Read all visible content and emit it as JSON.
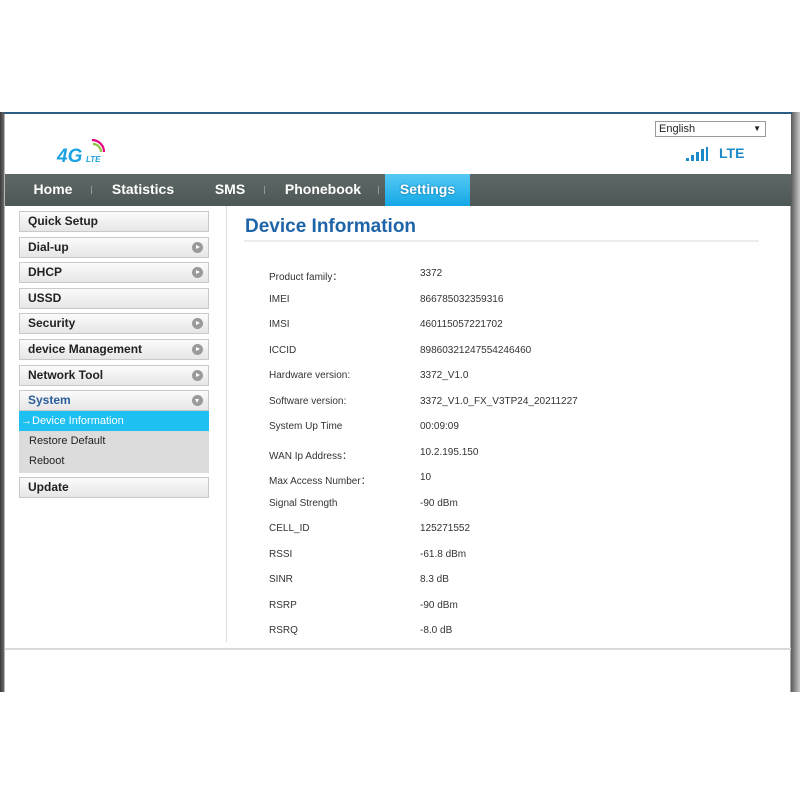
{
  "header": {
    "logo_text": "4G",
    "logo_sub": "LTE",
    "language": {
      "selected": "English"
    },
    "network_type": "LTE",
    "signal_bars": 4
  },
  "nav": {
    "items": [
      {
        "label": "Home",
        "active": false
      },
      {
        "label": "Statistics",
        "active": false
      },
      {
        "label": "SMS",
        "active": false
      },
      {
        "label": "Phonebook",
        "active": false
      },
      {
        "label": "Settings",
        "active": true
      }
    ]
  },
  "sidebar": {
    "items": [
      {
        "label": "Quick Setup",
        "arrow": false
      },
      {
        "label": "Dial-up",
        "arrow": true
      },
      {
        "label": "DHCP",
        "arrow": true
      },
      {
        "label": "USSD",
        "arrow": false
      },
      {
        "label": "Security",
        "arrow": true
      },
      {
        "label": "device Management",
        "arrow": true
      },
      {
        "label": "Network Tool",
        "arrow": true
      },
      {
        "label": "System",
        "arrow": "down",
        "open": true
      },
      {
        "label": "Update",
        "arrow": false
      }
    ],
    "system_submenu": [
      {
        "label": "→Device Information",
        "active": true
      },
      {
        "label": "Restore Default",
        "active": false
      },
      {
        "label": "Reboot",
        "active": false
      }
    ]
  },
  "content": {
    "title": "Device Information",
    "rows": [
      {
        "label": "Product family：",
        "value": "3372"
      },
      {
        "label": "IMEI",
        "value": "866785032359316"
      },
      {
        "label": "IMSI",
        "value": "460115057221702"
      },
      {
        "label": "ICCID",
        "value": "89860321247554246460"
      },
      {
        "label": "Hardware version:",
        "value": "3372_V1.0"
      },
      {
        "label": "Software version:",
        "value": "3372_V1.0_FX_V3TP24_20211227"
      },
      {
        "label": "System Up Time",
        "value": "00:09:09"
      },
      {
        "label": "WAN Ip Address：",
        "value": "10.2.195.150"
      },
      {
        "label": "Max Access Number：",
        "value": "10"
      },
      {
        "label": "Signal Strength",
        "value": "-90 dBm"
      },
      {
        "label": "CELL_ID",
        "value": "125271552"
      },
      {
        "label": "RSSI",
        "value": "-61.8 dBm"
      },
      {
        "label": "SINR",
        "value": "8.3 dB"
      },
      {
        "label": "RSRP",
        "value": "-90 dBm"
      },
      {
        "label": "RSRQ",
        "value": "-8.0 dB"
      }
    ]
  },
  "colors": {
    "accent": "#1ec0f2",
    "title_blue": "#1e64a8",
    "nav_bg": "#555f5d"
  }
}
